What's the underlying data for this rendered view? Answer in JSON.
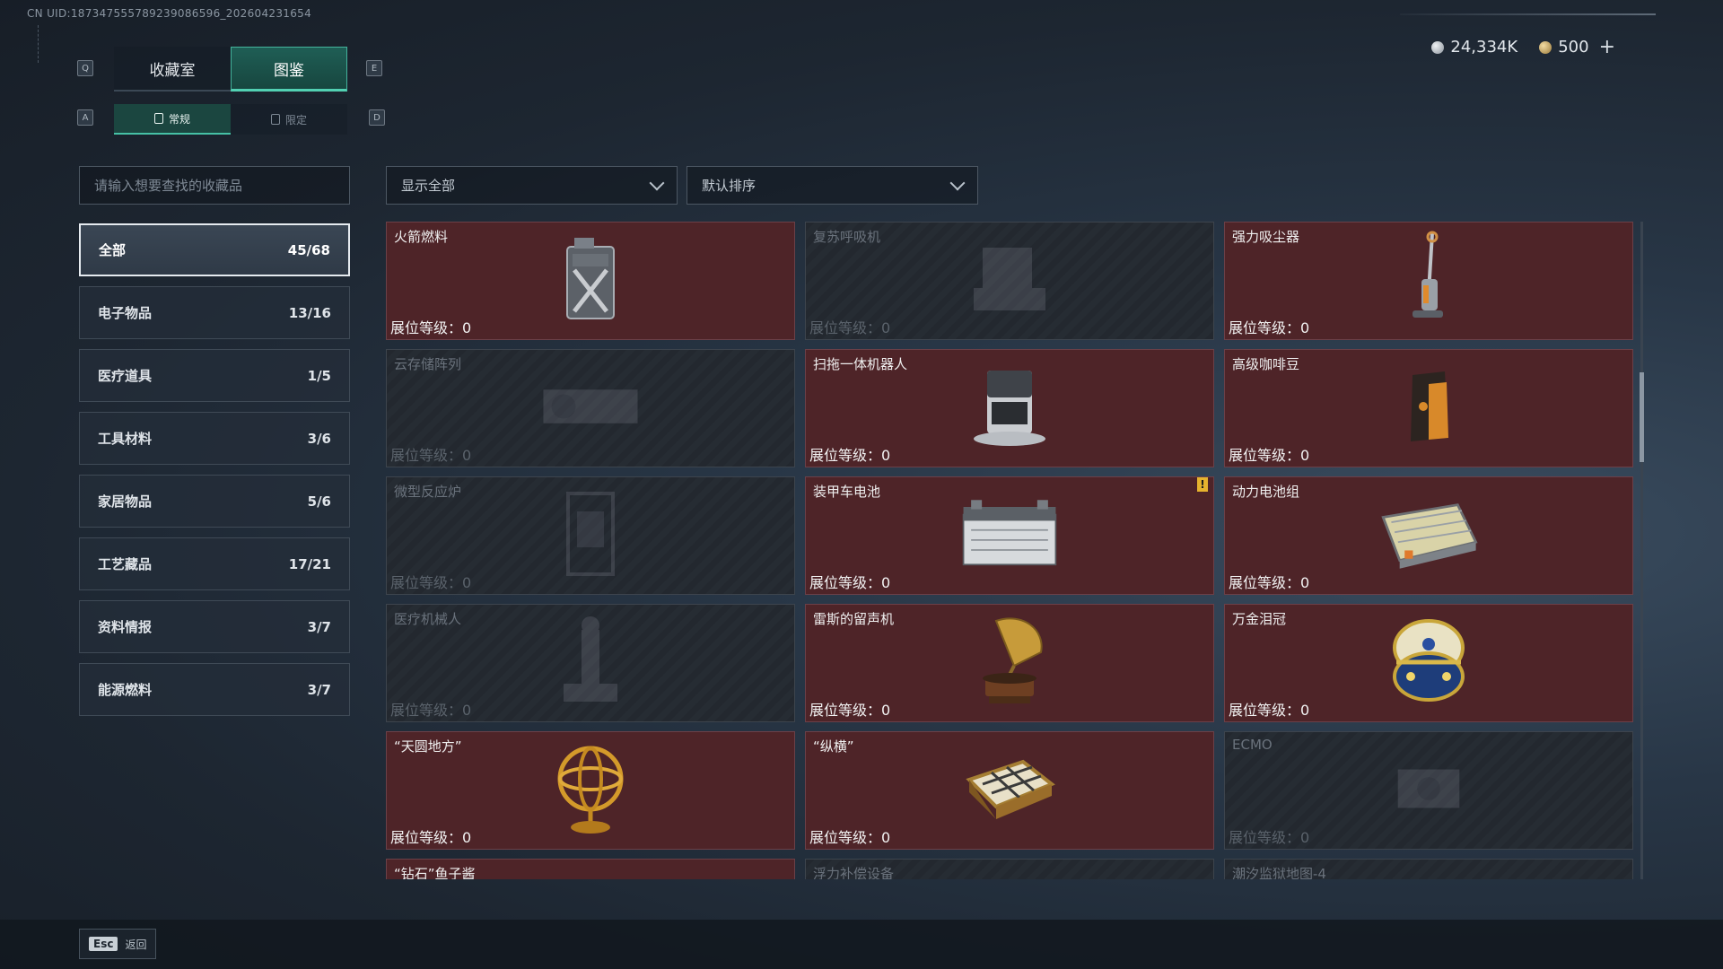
{
  "uid": "CN UID:187347555789239086596_202604231654",
  "currency": {
    "silver": "24,334K",
    "gold": "500",
    "add_label": "+"
  },
  "keys": {
    "prev_tab": "Q",
    "next_tab": "E",
    "prev_sub": "A",
    "next_sub": "D"
  },
  "main_tabs": [
    {
      "label": "收藏室",
      "active": false
    },
    {
      "label": "图鉴",
      "active": true
    }
  ],
  "sub_tabs": [
    {
      "label": "常规",
      "active": true
    },
    {
      "label": "限定",
      "active": false
    }
  ],
  "search": {
    "placeholder": "请输入想要查找的收藏品"
  },
  "filter": {
    "value": "显示全部"
  },
  "sort": {
    "value": "默认排序"
  },
  "categories": [
    {
      "label": "全部",
      "count": "45/68",
      "active": true
    },
    {
      "label": "电子物品",
      "count": "13/16"
    },
    {
      "label": "医疗道具",
      "count": "1/5"
    },
    {
      "label": "工具材料",
      "count": "3/6"
    },
    {
      "label": "家居物品",
      "count": "5/6"
    },
    {
      "label": "工艺藏品",
      "count": "17/21"
    },
    {
      "label": "资料情报",
      "count": "3/7"
    },
    {
      "label": "能源燃料",
      "count": "3/7"
    }
  ],
  "level_label": "展位等级：0",
  "items": [
    {
      "name": "火箭燃料",
      "locked": false,
      "icon": "fuel-can-icon"
    },
    {
      "name": "复苏呼吸机",
      "locked": true,
      "icon": "ventilator-icon"
    },
    {
      "name": "强力吸尘器",
      "locked": false,
      "icon": "vacuum-icon"
    },
    {
      "name": "云存储阵列",
      "locked": true,
      "icon": "storage-array-icon"
    },
    {
      "name": "扫拖一体机器人",
      "locked": false,
      "icon": "robot-vacuum-icon"
    },
    {
      "name": "高级咖啡豆",
      "locked": false,
      "icon": "coffee-bag-icon"
    },
    {
      "name": "微型反应炉",
      "locked": true,
      "icon": "reactor-icon"
    },
    {
      "name": "装甲车电池",
      "locked": false,
      "icon": "battery-icon",
      "warn": "!"
    },
    {
      "name": "动力电池组",
      "locked": false,
      "icon": "battery-pack-icon"
    },
    {
      "name": "医疗机械人",
      "locked": true,
      "icon": "medical-robot-icon"
    },
    {
      "name": "雷斯的留声机",
      "locked": false,
      "icon": "gramophone-icon"
    },
    {
      "name": "万金泪冠",
      "locked": false,
      "icon": "jeweled-egg-icon"
    },
    {
      "name": "“天圆地方”",
      "locked": false,
      "icon": "armillary-icon"
    },
    {
      "name": "“纵横”",
      "locked": false,
      "icon": "chessboard-icon"
    },
    {
      "name": "ECMO",
      "locked": true,
      "icon": "ecmo-icon"
    },
    {
      "name": "“钻石”鱼子酱",
      "locked": false,
      "icon": "caviar-icon",
      "partial": true
    },
    {
      "name": "浮力补偿设备",
      "locked": true,
      "icon": "bcd-icon",
      "partial": true
    },
    {
      "name": "潮汐监狱地图-4",
      "locked": true,
      "icon": "map-icon",
      "partial": true
    }
  ],
  "back": {
    "key": "Esc",
    "label": "返回"
  }
}
